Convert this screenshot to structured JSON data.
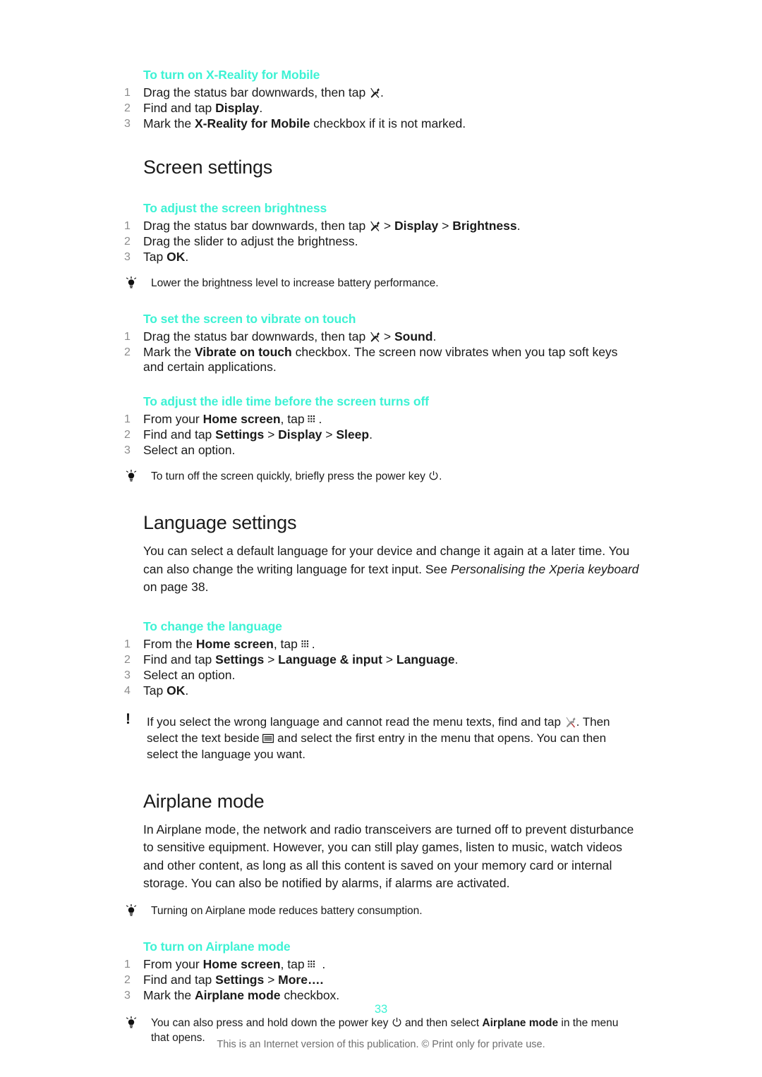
{
  "document": {
    "page_number": "33",
    "footer_note": "This is an Internet version of this publication. © Print only for private use.",
    "accent_color": "#3df2d4",
    "step_number_color": "#8c8c8c"
  },
  "proc_xreality": {
    "title": "To turn on X-Reality for Mobile",
    "steps": [
      {
        "num": "1",
        "pre": "Drag the status bar downwards, then tap ",
        "icon": "tools-icon",
        "post": "."
      },
      {
        "num": "2",
        "pre": "Find and tap ",
        "bold": "Display",
        "post": "."
      },
      {
        "num": "3",
        "pre": "Mark the ",
        "bold": "X-Reality for Mobile",
        "post": " checkbox if it is not marked."
      }
    ]
  },
  "screen_settings": {
    "title": "Screen settings",
    "proc_brightness": {
      "title": "To adjust the screen brightness",
      "steps": [
        {
          "num": "1",
          "pre": "Drag the status bar downwards, then tap ",
          "icon": "tools-icon",
          "mid": " > ",
          "bold1": "Display",
          "sep": " > ",
          "bold2": "Brightness",
          "post": "."
        },
        {
          "num": "2",
          "text": "Drag the slider to adjust the brightness."
        },
        {
          "num": "3",
          "pre": "Tap ",
          "bold": "OK",
          "post": "."
        }
      ],
      "tip": "Lower the brightness level to increase battery performance.",
      "tip_icon": "lightbulb-icon"
    },
    "proc_vibrate": {
      "title": "To set the screen to vibrate on touch",
      "steps": [
        {
          "num": "1",
          "pre": "Drag the status bar downwards, then tap ",
          "icon": "tools-icon",
          "mid": " > ",
          "bold1": "Sound",
          "post": "."
        },
        {
          "num": "2",
          "pre": "Mark the ",
          "bold": "Vibrate on touch",
          "post": " checkbox. The screen now vibrates when you tap soft keys and certain applications."
        }
      ]
    },
    "proc_idle": {
      "title": "To adjust the idle time before the screen turns off",
      "steps": [
        {
          "num": "1",
          "pre": "From your ",
          "bold": "Home screen",
          "mid": ", tap ",
          "icon": "app-grid-icon",
          "post": "."
        },
        {
          "num": "2",
          "pre": "Find and tap ",
          "bold1": "Settings",
          "sep1": " > ",
          "bold2": "Display",
          "sep2": " > ",
          "bold3": "Sleep",
          "post": "."
        },
        {
          "num": "3",
          "text": "Select an option."
        }
      ],
      "tip_pre": "To turn off the screen quickly, briefly press the power key ",
      "tip_icon_inline": "power-icon",
      "tip_post": ".",
      "tip_icon": "lightbulb-icon"
    }
  },
  "language_settings": {
    "title": "Language settings",
    "intro_part1": "You can select a default language for your device and change it again at a later time. You can also change the writing language for text input. See ",
    "intro_italic": "Personalising the Xperia keyboard",
    "intro_part2": " on page 38.",
    "proc_change": {
      "title": "To change the language",
      "steps": [
        {
          "num": "1",
          "pre": "From the ",
          "bold": "Home screen",
          "mid": ", tap ",
          "icon": "app-grid-icon",
          "post": "."
        },
        {
          "num": "2",
          "pre": "Find and tap ",
          "bold1": "Settings",
          "sep1": " > ",
          "bold2": "Language & input",
          "sep2": " > ",
          "bold3": "Language",
          "post": "."
        },
        {
          "num": "3",
          "text": "Select an option."
        },
        {
          "num": "4",
          "pre": "Tap ",
          "bold": "OK",
          "post": "."
        }
      ]
    },
    "warning": {
      "icon": "exclamation-icon",
      "part1": "If you select the wrong language and cannot read the menu texts, find and tap ",
      "icon_inline1": "tools-color-icon",
      "part2": ". Then select the text beside ",
      "icon_inline2": "keyboard-icon",
      "part3": " and select the first entry in the menu that opens. You can then select the language you want."
    }
  },
  "airplane_mode": {
    "title": "Airplane mode",
    "intro": "In Airplane mode, the network and radio transceivers are turned off to prevent disturbance to sensitive equipment. However, you can still play games, listen to music, watch videos and other content, as long as all this content is saved on your memory card or internal storage. You can also be notified by alarms, if alarms are activated.",
    "tip": "Turning on Airplane mode reduces battery consumption.",
    "tip_icon": "lightbulb-icon",
    "proc_turn_on": {
      "title": "To turn on Airplane mode",
      "steps": [
        {
          "num": "1",
          "pre": "From your ",
          "bold": "Home screen",
          "mid": ", tap ",
          "icon": "app-grid-icon",
          "post": " ."
        },
        {
          "num": "2",
          "pre": "Find and tap ",
          "bold1": "Settings",
          "sep1": " > ",
          "bold2": "More….",
          "post": ""
        },
        {
          "num": "3",
          "pre": "Mark the ",
          "bold": "Airplane mode",
          "post": " checkbox."
        }
      ],
      "tip_pre": "You can also press and hold down the power key ",
      "tip_icon_inline": "power-icon",
      "tip_mid": " and then select ",
      "tip_bold": "Airplane mode",
      "tip_post": " in the menu that opens.",
      "tip_icon": "lightbulb-icon"
    }
  }
}
